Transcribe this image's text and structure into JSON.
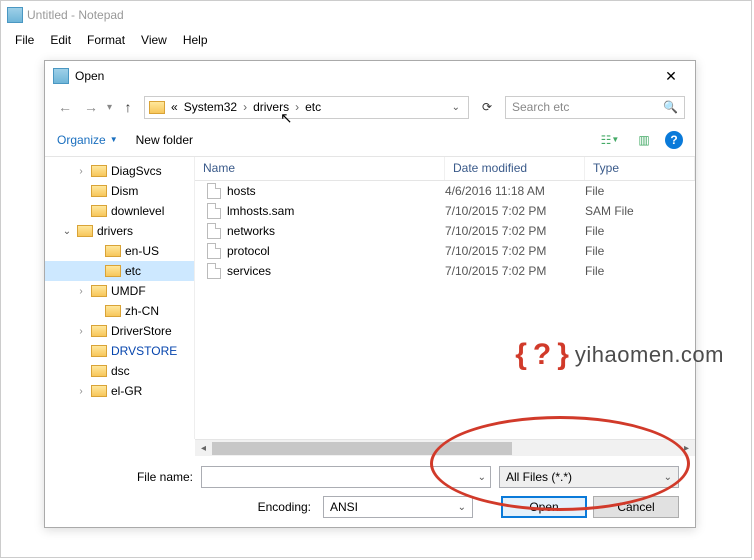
{
  "notepad": {
    "title": "Untitled - Notepad",
    "menu": [
      "File",
      "Edit",
      "Format",
      "View",
      "Help"
    ]
  },
  "dialog": {
    "title": "Open",
    "breadcrumb": {
      "pre": "«",
      "p1": "System32",
      "p2": "drivers",
      "p3": "etc"
    },
    "search_placeholder": "Search etc",
    "toolbar": {
      "organize": "Organize",
      "newfolder": "New folder"
    },
    "tree": [
      {
        "indent": 30,
        "chev": "›",
        "label": "DiagSvcs"
      },
      {
        "indent": 30,
        "chev": "",
        "label": "Dism"
      },
      {
        "indent": 30,
        "chev": "",
        "label": "downlevel"
      },
      {
        "indent": 16,
        "chev": "⌄",
        "label": "drivers",
        "open": true
      },
      {
        "indent": 44,
        "chev": "",
        "label": "en-US"
      },
      {
        "indent": 44,
        "chev": "",
        "label": "etc",
        "sel": true
      },
      {
        "indent": 30,
        "chev": "›",
        "label": "UMDF"
      },
      {
        "indent": 44,
        "chev": "",
        "label": "zh-CN"
      },
      {
        "indent": 30,
        "chev": "›",
        "label": "DriverStore"
      },
      {
        "indent": 30,
        "chev": "",
        "label": "DRVSTORE",
        "blue": true
      },
      {
        "indent": 30,
        "chev": "",
        "label": "dsc"
      },
      {
        "indent": 30,
        "chev": "›",
        "label": "el-GR"
      }
    ],
    "columns": {
      "name": "Name",
      "date": "Date modified",
      "type": "Type"
    },
    "files": [
      {
        "name": "hosts",
        "date": "4/6/2016 11:18 AM",
        "type": "File"
      },
      {
        "name": "lmhosts.sam",
        "date": "7/10/2015 7:02 PM",
        "type": "SAM File"
      },
      {
        "name": "networks",
        "date": "7/10/2015 7:02 PM",
        "type": "File"
      },
      {
        "name": "protocol",
        "date": "7/10/2015 7:02 PM",
        "type": "File"
      },
      {
        "name": "services",
        "date": "7/10/2015 7:02 PM",
        "type": "File"
      }
    ],
    "footer": {
      "filename_label": "File name:",
      "filter": "All Files  (*.*)",
      "encoding_label": "Encoding:",
      "encoding": "ANSI",
      "open": "Open",
      "cancel": "Cancel"
    }
  },
  "watermark": "yihaomen.com"
}
